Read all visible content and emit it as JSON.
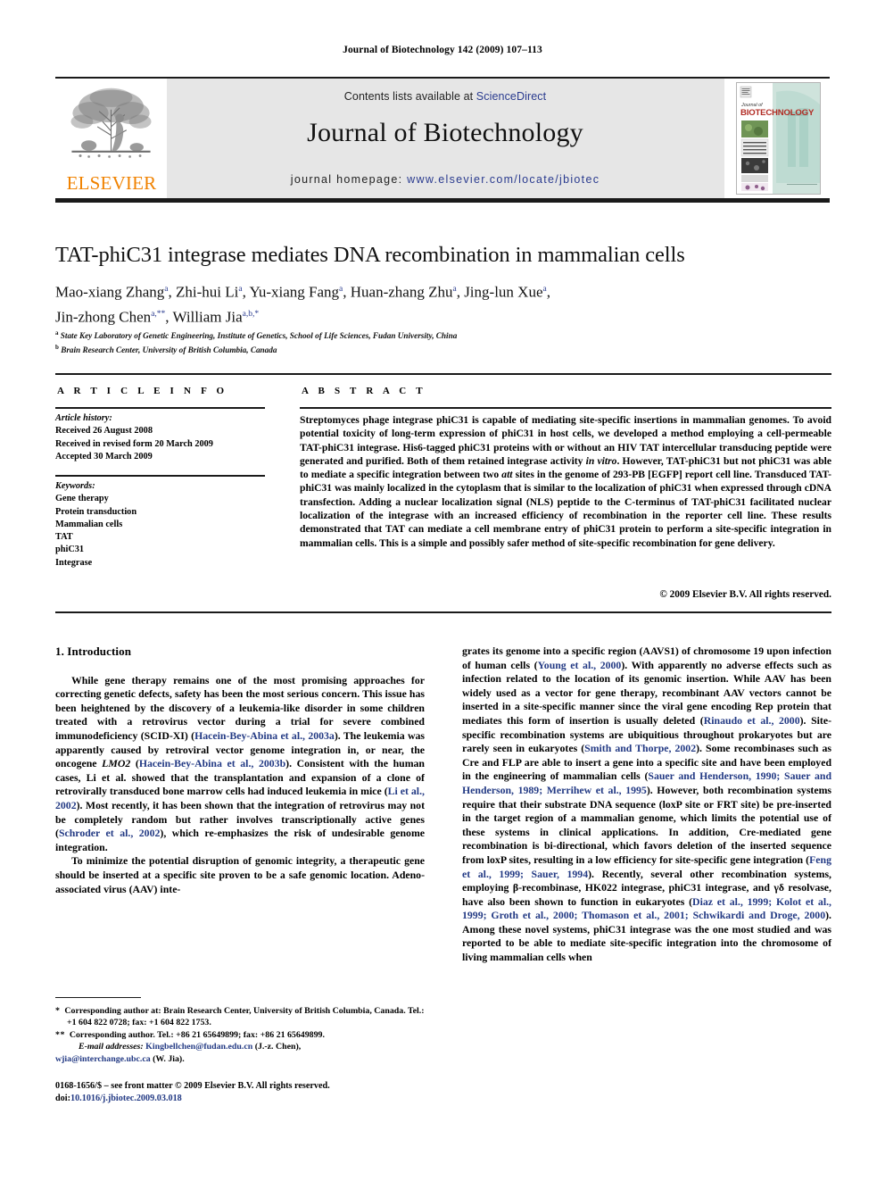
{
  "running_head": "Journal of Biotechnology 142 (2009) 107–113",
  "masthead": {
    "publisher_name": "ELSEVIER",
    "contents_prefix": "Contents lists available at ",
    "contents_link": "ScienceDirect",
    "journal_name": "Journal of Biotechnology",
    "homepage_prefix": "journal homepage: ",
    "homepage_url": "www.elsevier.com/locate/jbiotec",
    "cover": {
      "kicker": "Journal of",
      "title": "BIOTECHNOLOGY"
    }
  },
  "article": {
    "title": "TAT-phiC31 integrase mediates DNA recombination in mammalian cells",
    "authors_line1": "Mao-xiang Zhang a, Zhi-hui Li a, Yu-xiang Fang a, Huan-zhang Zhu a, Jing-lun Xue a,",
    "authors_line2": "Jin-zhong Chen a,**, William Jia a,b,*",
    "affiliation_a": "State Key Laboratory of Genetic Engineering, Institute of Genetics, School of Life Sciences, Fudan University, China",
    "affiliation_b": "Brain Research Center, University of British Columbia, Canada"
  },
  "article_info": {
    "heading": "A R T I C L E   I N F O",
    "history_label": "Article history:",
    "history": [
      "Received 26 August 2008",
      "Received in revised form 20 March 2009",
      "Accepted 30 March 2009"
    ],
    "keywords_label": "Keywords:",
    "keywords": [
      "Gene therapy",
      "Protein transduction",
      "Mammalian cells",
      "TAT",
      "phiC31",
      "Integrase"
    ]
  },
  "abstract": {
    "heading": "A B S T R A C T",
    "text_part1": "Streptomyces phage integrase phiC31 is capable of mediating site-specific insertions in mammalian genomes. To avoid potential toxicity of long-term expression of phiC31 in host cells, we developed a method employing a cell-permeable TAT-phiC31 integrase. His6-tagged phiC31 proteins with or without an HIV TAT intercellular transducing peptide were generated and purified. Both of them retained integrase activity ",
    "italic1": "in vitro",
    "text_part2": ". However, TAT-phiC31 but not phiC31 was able to mediate a specific integration between two ",
    "italic2": "att",
    "text_part3": " sites in the genome of 293-PB [EGFP] report cell line. Transduced TAT-phiC31 was mainly localized in the cytoplasm that is similar to the localization of phiC31 when expressed through cDNA transfection. Adding a nuclear localization signal (NLS) peptide to the C-terminus of TAT-phiC31 facilitated nuclear localization of the integrase with an increased efficiency of recombination in the reporter cell line. These results demonstrated that TAT can mediate a cell membrane entry of phiC31 protein to perform a site-specific integration in mammalian cells. This is a simple and possibly safer method of site-specific recombination for gene delivery.",
    "copyright": "© 2009 Elsevier B.V. All rights reserved."
  },
  "introduction": {
    "heading": "1.  Introduction",
    "left_paragraph_1_a": "While gene therapy remains one of the most promising approaches for correcting genetic defects, safety has been the most serious concern. This issue has been heightened by the discovery of a leukemia-like disorder in some children treated with a retrovirus vector during a trial for severe combined immunodeficiency (SCID-XI) (",
    "left_ref_1": "Hacein-Bey-Abina et al., 2003a",
    "left_paragraph_1_b": "). The leukemia was apparently caused by retroviral vector genome integration in, or near, the oncogene ",
    "left_italic_1": "LMO2",
    "left_paragraph_1_c": " (",
    "left_ref_2": "Hacein-Bey-Abina et al., 2003b",
    "left_paragraph_1_d": "). Consistent with the human cases, Li et al. showed that the transplantation and expansion of a clone of retrovirally transduced bone marrow cells had induced leukemia in mice (",
    "left_ref_3": "Li et al., 2002",
    "left_paragraph_1_e": "). Most recently, it has been shown that the integration of retrovirus may not be completely random but rather involves transcriptionally active genes (",
    "left_ref_4": "Schroder et al., 2002",
    "left_paragraph_1_f": "), which re-emphasizes the risk of undesirable genome integration.",
    "left_paragraph_2": "To minimize the potential disruption of genomic integrity, a therapeutic gene should be inserted at a specific site proven to be a safe genomic location. Adeno-associated virus (AAV) inte-",
    "right_a": "grates its genome into a specific region (AAVS1) of chromosome 19 upon infection of human cells (",
    "right_ref_1": "Young et al., 2000",
    "right_b": "). With apparently no adverse effects such as infection related to the location of its genomic insertion. While AAV has been widely used as a vector for gene therapy, recombinant AAV vectors cannot be inserted in a site-specific manner since the viral gene encoding Rep protein that mediates this form of insertion is usually deleted (",
    "right_ref_2": "Rinaudo et al., 2000",
    "right_c": "). Site-specific recombination systems are ubiquitious throughout prokaryotes but are rarely seen in eukaryotes (",
    "right_ref_3": "Smith and Thorpe, 2002",
    "right_d": "). Some recombinases such as Cre and FLP are able to insert a gene into a specific site and have been employed in the engineering of mammalian cells (",
    "right_ref_4": "Sauer and Henderson, 1990; Sauer and Henderson, 1989; Merrihew et al., 1995",
    "right_e": "). However, both recombination systems require that their substrate DNA sequence (loxP site or FRT site) be pre-inserted in the target region of a mammalian genome, which limits the potential use of these systems in clinical applications. In addition, Cre-mediated gene recombination is bi-directional, which favors deletion of the inserted sequence from loxP sites, resulting in a low efficiency for site-specific gene integration (",
    "right_ref_5": "Feng et al., 1999; Sauer, 1994",
    "right_f": "). Recently, several other recombination systems, employing β-recombinase, HK022 integrase, phiC31 integrase, and γδ resolvase, have also been shown to function in eukaryotes (",
    "right_ref_6": "Diaz et al., 1999; Kolot et al., 1999; Groth et al., 2000; Thomason et al., 2001; Schwikardi and Droge, 2000",
    "right_g": "). Among these novel systems, phiC31 integrase was the one most studied and was reported to be able to mediate site-specific integration into the chromosome of living mammalian cells when"
  },
  "footnotes": {
    "fn1_marker": "*",
    "fn1_text": "Corresponding author at: Brain Research Center, University of British Columbia, Canada. Tel.: +1 604 822 0728; fax: +1 604 822 1753.",
    "fn2_marker": "**",
    "fn2_text": "Corresponding author. Tel.: +86 21 65649899; fax: +86 21 65649899.",
    "email_label": "E-mail addresses:",
    "email1": "Kingbellchen@fudan.edu.cn",
    "email1_owner": " (J.-z. Chen),",
    "email2": "wjia@interchange.ubc.ca",
    "email2_owner": " (W. Jia)."
  },
  "imprint": {
    "line1": "0168-1656/$ – see front matter © 2009 Elsevier B.V. All rights reserved.",
    "doi_label": "doi:",
    "doi": "10.1016/j.jbiotec.2009.03.018"
  },
  "colors": {
    "elsevier_orange": "#F08200",
    "link_blue": "#2a3b8f",
    "reference_blue": "#233a84",
    "banner_gray": "#e6e6e6"
  }
}
